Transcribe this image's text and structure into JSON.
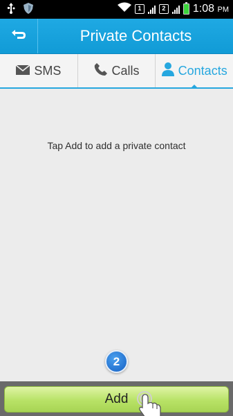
{
  "status_bar": {
    "time": "1:08",
    "ampm": "PM",
    "sim1": "1",
    "sim2": "2"
  },
  "app_bar": {
    "title": "Private Contacts",
    "back_icon": "back-arrow-icon"
  },
  "tabs": [
    {
      "label": "SMS",
      "icon": "envelope-icon",
      "active": false
    },
    {
      "label": "Calls",
      "icon": "phone-icon",
      "active": false
    },
    {
      "label": "Contacts",
      "icon": "person-icon",
      "active": true
    }
  ],
  "content": {
    "empty_message": "Tap Add to add a private contact"
  },
  "step_badge": "2",
  "add_button": {
    "label": "Add"
  },
  "colors": {
    "accent": "#1fa9e3",
    "add_button": "#b8e266"
  }
}
